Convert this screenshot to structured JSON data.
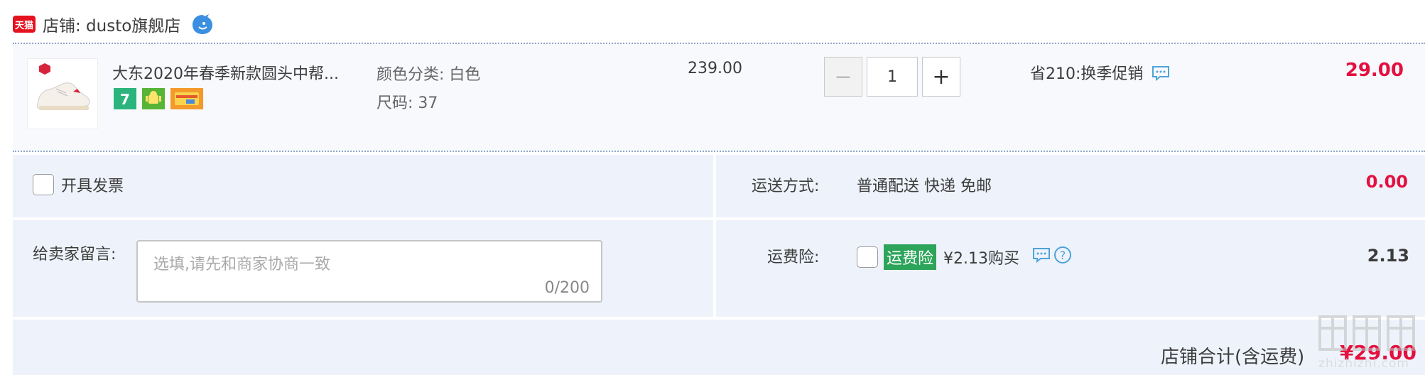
{
  "shop": {
    "badge": "天猫",
    "label": "店铺: dusto旗舰店"
  },
  "item": {
    "title": "大东2020年春季新款圆头中帮...",
    "sku_color": "颜色分类: 白色",
    "sku_size": "尺码: 37",
    "unit_price": "239.00",
    "quantity": "1",
    "qty_minus": "−",
    "qty_plus": "+",
    "promo": "省210:换季促销",
    "total": "29.00",
    "service_icons": [
      "7-day-return-icon",
      "android-icon",
      "credit-card-icon"
    ]
  },
  "invoice": {
    "label": "开具发票"
  },
  "message": {
    "label": "给卖家留言:",
    "placeholder": "选填,请先和商家协商一致",
    "count": "0/200"
  },
  "shipping": {
    "label": "运送方式:",
    "value": "普通配送 快递 免邮",
    "cost": "0.00"
  },
  "insurance": {
    "label": "运费险:",
    "tag": "运费险",
    "price_text": "¥2.13购买",
    "cost": "2.13"
  },
  "summary": {
    "label": "店铺合计(含运费)",
    "value": "¥29.00"
  },
  "watermark": "zhizhizhi.com",
  "colors": {
    "accent_red": "#e4103f",
    "panel_bg": "#eef3fb",
    "insurance_green": "#2ca45a",
    "tmall_red": "#e4121e"
  }
}
